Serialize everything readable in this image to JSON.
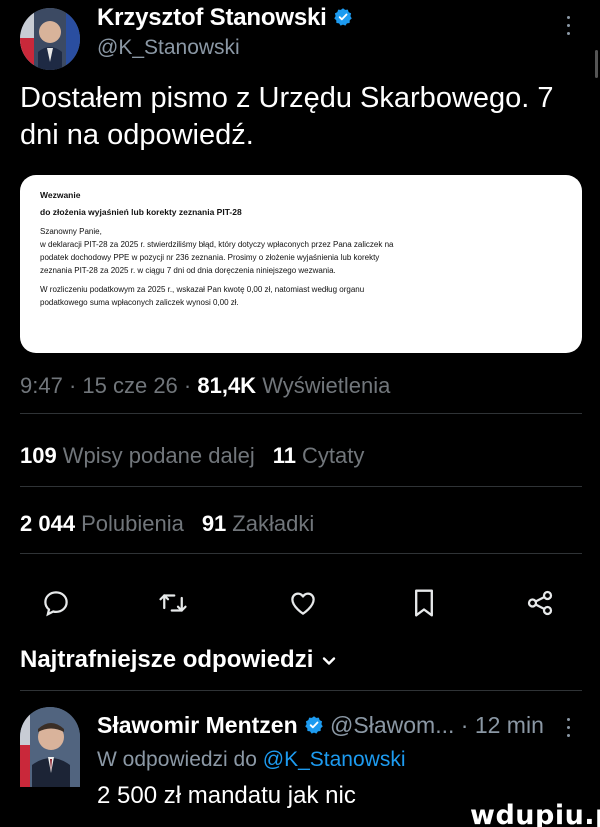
{
  "post": {
    "author_name": "Krzysztof Stanowski",
    "author_handle": "@K_Stanowski",
    "text": "Dostałem pismo z Urzędu Skarbowego. 7 dni na odpowiedź.",
    "verified_color": "#1d9bf0"
  },
  "document": {
    "title": "Wezwanie",
    "subtitle": "do złożenia wyjaśnień lub korekty zeznania PIT-28",
    "greeting": "Szanowny Panie,",
    "body_lines": [
      "w deklaracji PIT-28 za 2025 r. stwierdziliśmy błąd, który dotyczy wpłaconych przez Pana zaliczek na",
      "podatek dochodowy PPE w pozycji nr 236 zeznania. Prosimy o złożenie wyjaśnienia lub korekty",
      "zeznania PIT-28 za 2025 r. w ciągu 7 dni od dnia doręczenia niniejszego wezwania."
    ],
    "body_lines_2": [
      "W rozliczeniu podatkowym za 2025 r., wskazał Pan kwotę 0,00 zł, natomiast według organu",
      "podatkowego suma wpłaconych zaliczek wynosi 0,00 zł."
    ]
  },
  "meta": {
    "time": "9:47",
    "date": "15 cze 26",
    "views_count": "81,4K",
    "views_label": "Wyświetlenia"
  },
  "stats": {
    "quotes_count": "109",
    "quotes_label": "Wpisy podane dalej",
    "citations_count": "11",
    "citations_label": "Cytaty",
    "likes_count": "2 044",
    "likes_label": "Polubienia",
    "bookmarks_count": "91",
    "bookmarks_label": "Zakładki"
  },
  "actions": [
    "reply-icon",
    "repost-icon",
    "like-icon",
    "bookmark-icon",
    "share-icon"
  ],
  "replies": {
    "header": "Najtrafniejsze odpowiedzi"
  },
  "reply": {
    "author_name": "Sławomir Mentzen",
    "handle": "@Sławom...",
    "time": "12 min",
    "replying_prefix": "W odpowiedzi do",
    "replying_to": "@K_Stanowski",
    "text": "2 500 zł mandatu jak nic"
  },
  "watermark": "wdupiu.pl",
  "colors": {
    "background": "#000000",
    "text": "#e7e9ea",
    "muted": "#71767b",
    "accent": "#1d9bf0"
  }
}
